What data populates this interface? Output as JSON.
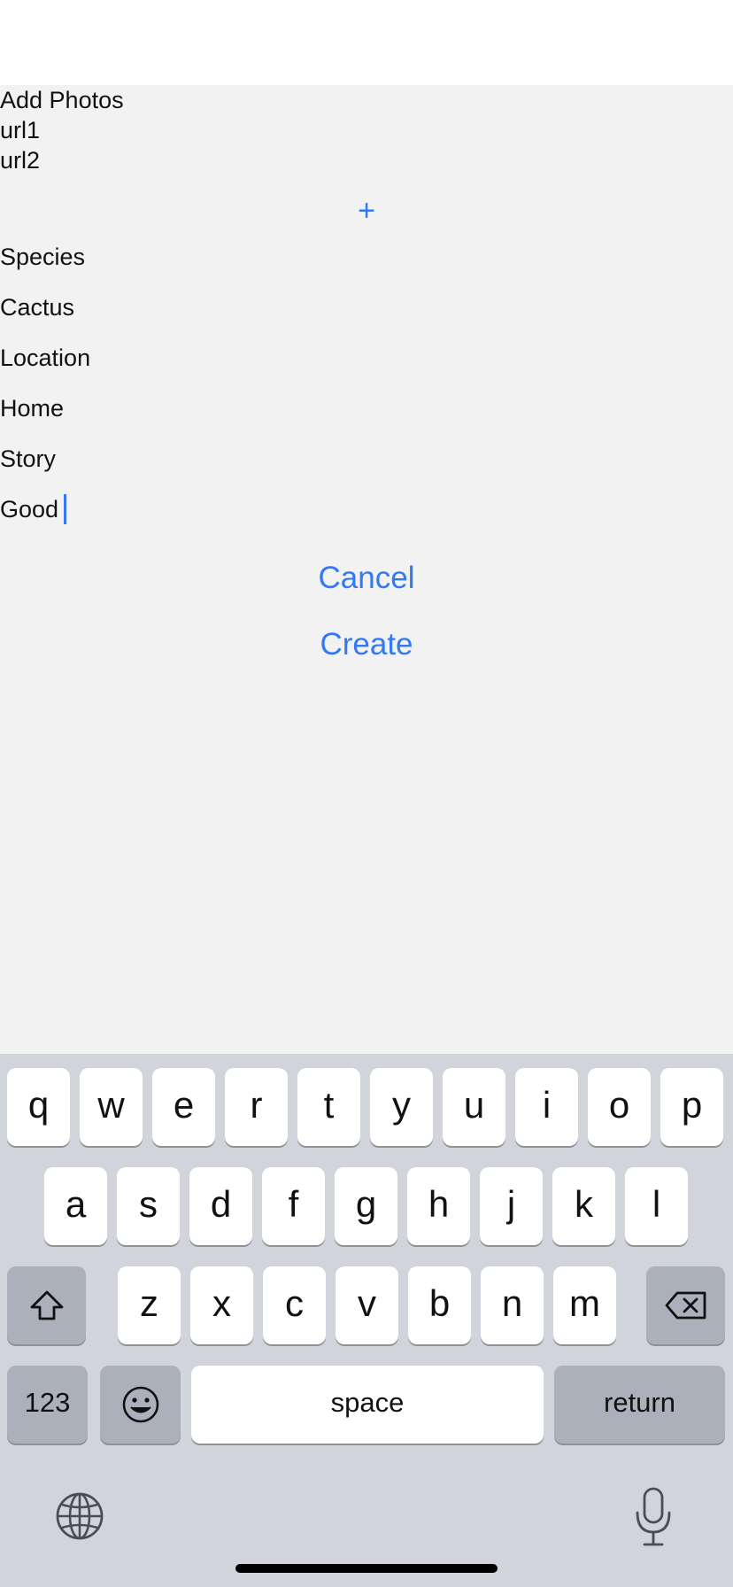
{
  "form": {
    "add_photos_label": "Add Photos",
    "photos": [
      "url1",
      "url2"
    ],
    "add_photo_button": "+",
    "species_label": "Species",
    "species_value": "Cactus",
    "location_label": "Location",
    "location_value": "Home",
    "story_label": "Story",
    "story_value": "Good",
    "cancel_label": "Cancel",
    "create_label": "Create"
  },
  "keyboard": {
    "row1": [
      "q",
      "w",
      "e",
      "r",
      "t",
      "y",
      "u",
      "i",
      "o",
      "p"
    ],
    "row2": [
      "a",
      "s",
      "d",
      "f",
      "g",
      "h",
      "j",
      "k",
      "l"
    ],
    "row3": [
      "z",
      "x",
      "c",
      "v",
      "b",
      "n",
      "m"
    ],
    "shift_icon": "shift-icon",
    "delete_icon": "backspace-icon",
    "numbers_label": "123",
    "emoji_icon": "emoji-icon",
    "space_label": "space",
    "return_label": "return",
    "globe_icon": "globe-icon",
    "mic_icon": "microphone-icon"
  },
  "colors": {
    "accent": "#3478f6",
    "form_background": "#f2f2f2",
    "keyboard_background": "#d2d4db"
  }
}
